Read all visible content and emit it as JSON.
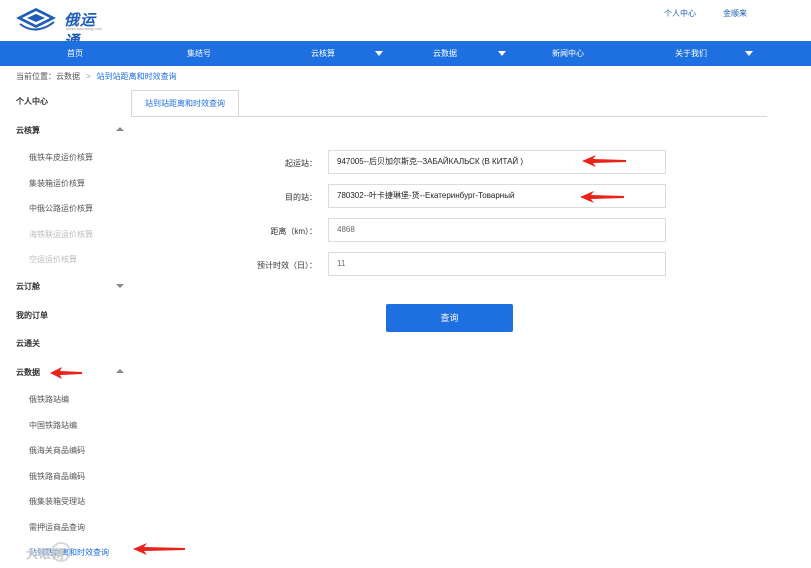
{
  "brand": {
    "name": "俄运通",
    "subtitle": "www.ruyuntong.com"
  },
  "top_links": {
    "personal_center": "个人中心",
    "user": "金顺来"
  },
  "nav": {
    "items": [
      {
        "label": "首页",
        "has_dropdown": false
      },
      {
        "label": "集结号",
        "has_dropdown": false
      },
      {
        "label": "云核算",
        "has_dropdown": true
      },
      {
        "label": "云数据",
        "has_dropdown": true
      },
      {
        "label": "新闻中心",
        "has_dropdown": false
      },
      {
        "label": "关于我们",
        "has_dropdown": true
      }
    ]
  },
  "breadcrumb": {
    "prefix": "当前位置：",
    "level1": "云数据",
    "separator": ">",
    "current": "站到站距离和时效查询"
  },
  "sidebar": {
    "personal_center": "个人中心",
    "cloud_calc": {
      "label": "云核算",
      "items": [
        {
          "label": "俄铁车皮运价核算",
          "disabled": false
        },
        {
          "label": "集装箱运价核算",
          "disabled": false
        },
        {
          "label": "中俄公路运价核算",
          "disabled": false
        },
        {
          "label": "海铁联运运价核算",
          "disabled": true
        },
        {
          "label": "空运运价核算",
          "disabled": true
        }
      ]
    },
    "cloud_booking": "云订舱",
    "my_orders": "我的订单",
    "cloud_customs": "云通关",
    "cloud_data": {
      "label": "云数据",
      "items": [
        {
          "label": "俄铁路站编",
          "active": false
        },
        {
          "label": "中国铁路站编",
          "active": false
        },
        {
          "label": "俄海关商品编码",
          "active": false
        },
        {
          "label": "俄铁路商品编码",
          "active": false
        },
        {
          "label": "俄集装箱受理站",
          "active": false
        },
        {
          "label": "需押运商品查询",
          "active": false
        },
        {
          "label": "站到站距离和时效查询",
          "active": true
        }
      ]
    }
  },
  "tab": {
    "label": "站到站距离和时效查询"
  },
  "form": {
    "origin": {
      "label": "起运站：",
      "value": "947005--后贝加尔斯克--ЗАБАЙКАЛЬСК (В КИТАЙ )"
    },
    "destination": {
      "label": "目的站：",
      "value": "780302--叶卡捷琳堡-货--Екатеринбург-Товарный"
    },
    "distance": {
      "label": "距离（km）：",
      "value": "4868"
    },
    "duration": {
      "label": "预计时效（日）：",
      "value": "11"
    },
    "query_button": "查询"
  },
  "colors": {
    "brand_blue": "#1e6fe0",
    "annotation_red": "#e8231a"
  },
  "watermark": {
    "text": "大眼网"
  }
}
